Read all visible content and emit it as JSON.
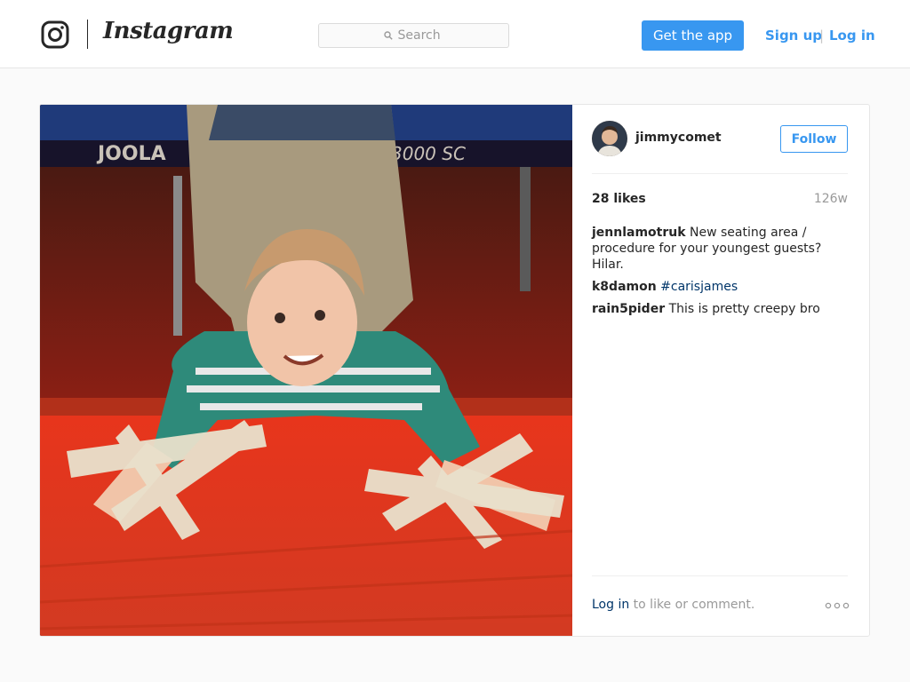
{
  "header": {
    "brand": "Instagram",
    "search_placeholder": "Search",
    "get_app_label": "Get the app",
    "signup_label": "Sign up",
    "separator": "|",
    "login_label": "Log in",
    "icons": {
      "logo": "camera-glyph-icon",
      "search": "magnifier-icon"
    }
  },
  "post": {
    "author": "jimmycomet",
    "follow_label": "Follow",
    "likes": "28 likes",
    "age": "126w",
    "comments": [
      {
        "user": "jennlamotruk",
        "text": "New seating area / procedure for your youngest guests? Hilar."
      },
      {
        "user": "k8damon",
        "text": "#carisjames"
      },
      {
        "user": "rain5pider",
        "text": "This is pretty creepy bro"
      }
    ],
    "footer": {
      "login_link": "Log in",
      "rest": " to like or comment."
    },
    "icons": {
      "more": "more-options-icon"
    },
    "photo_text": {
      "table_brand": "JOOLA",
      "table_model": "3000 SC"
    }
  },
  "colors": {
    "accent": "#3897f0",
    "link_dark": "#003569",
    "muted": "#999999",
    "text": "#262626",
    "page_bg": "#fafafa"
  }
}
